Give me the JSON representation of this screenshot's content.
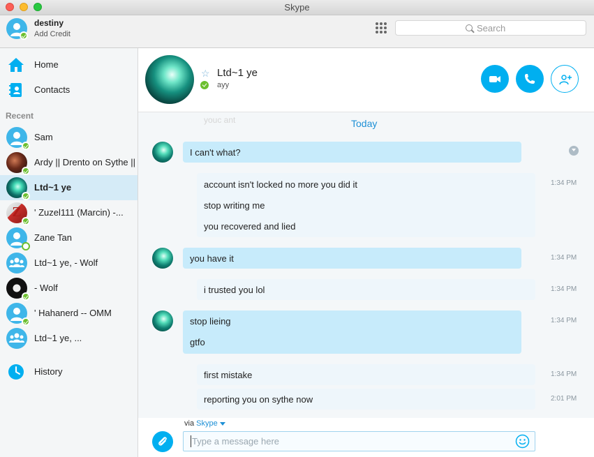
{
  "window": {
    "title": "Skype"
  },
  "profile": {
    "name": "destiny",
    "credit_label": "Add Credit"
  },
  "search": {
    "placeholder": "Search"
  },
  "sidebar": {
    "nav": [
      {
        "label": "Home",
        "icon": "home-icon"
      },
      {
        "label": "Contacts",
        "icon": "contacts-book-icon"
      }
    ],
    "recent_header": "Recent",
    "contacts": [
      {
        "name": "Sam",
        "status": "online",
        "avatar": "default-person"
      },
      {
        "name": "Ardy || Drento on Sythe ||",
        "status": "online",
        "avatar": "photo"
      },
      {
        "name": "Ltd~1 ye",
        "status": "online",
        "avatar": "photo",
        "active": true
      },
      {
        "name": "' Zuzel111 (Marcin) -...",
        "status": "online",
        "avatar": "photo"
      },
      {
        "name": "Zane Tan",
        "status": "away",
        "avatar": "default-person"
      },
      {
        "name": "Ltd~1 ye, - Wolf",
        "status": "group",
        "avatar": "group"
      },
      {
        "name": "- Wolf",
        "status": "online",
        "avatar": "photo"
      },
      {
        "name": "' Hahanerd -- OMM",
        "status": "online",
        "avatar": "default-person"
      },
      {
        "name": "Ltd~1 ye, ...",
        "status": "group",
        "avatar": "group"
      }
    ],
    "history_label": "History"
  },
  "chat": {
    "contact_name": "Ltd~1 ye",
    "mood": "ayy",
    "faded_text": "youc ant",
    "date_divider": "Today",
    "messages": [
      {
        "direction": "in",
        "lines": [
          "I can't what?"
        ],
        "time": ""
      },
      {
        "direction": "out",
        "lines": [
          "account isn't locked no more you did it",
          "stop writing me",
          "you recovered and lied"
        ],
        "time": "1:34 PM"
      },
      {
        "direction": "in",
        "lines": [
          "you have it"
        ],
        "time": "1:34 PM"
      },
      {
        "direction": "out",
        "lines": [
          "i trusted you lol"
        ],
        "time": "1:34 PM"
      },
      {
        "direction": "in",
        "lines": [
          "stop lieing",
          "gtfo"
        ],
        "time": "1:34 PM"
      },
      {
        "direction": "out",
        "lines": [
          "first mistake"
        ],
        "time": "1:34 PM"
      },
      {
        "direction": "out",
        "lines": [
          "reporting you on sythe now"
        ],
        "time": "2:01 PM"
      }
    ]
  },
  "composer": {
    "via_prefix": "via",
    "via_service": "Skype",
    "placeholder": "Type a message here"
  },
  "colors": {
    "accent": "#00aff0",
    "online": "#6cbf2f",
    "incoming_bubble": "#c7ebfb",
    "outgoing_bubble": "#eef6fb",
    "active_row": "#d5ebf7"
  }
}
